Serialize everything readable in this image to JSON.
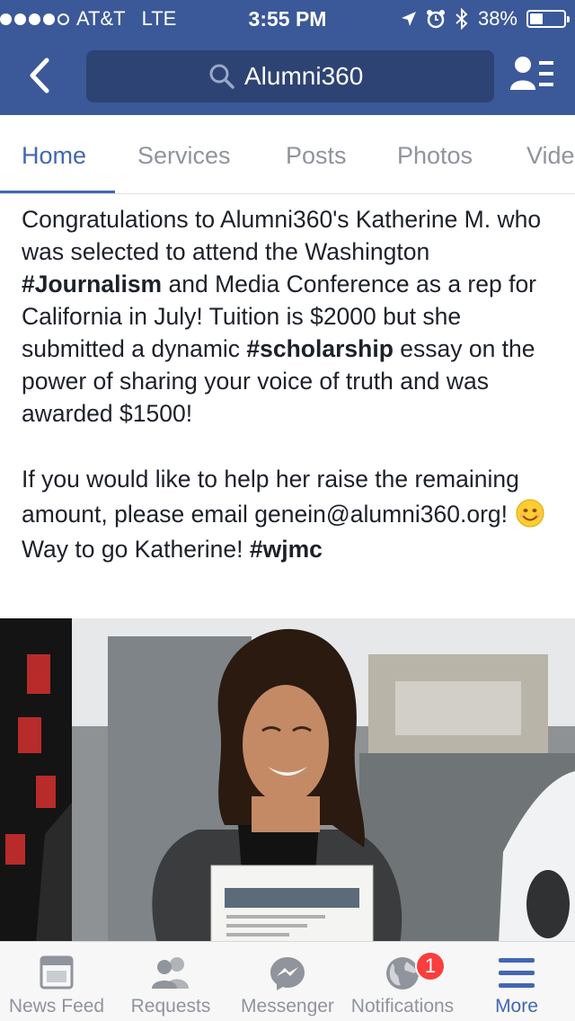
{
  "status_bar": {
    "carrier": "AT&T",
    "network": "LTE",
    "time": "3:55 PM",
    "battery_percent": "38%",
    "battery_level": 0.38,
    "signal_bars": 4,
    "signal_max": 5
  },
  "nav": {
    "search_value": "Alumni360",
    "back_icon": "chevron-left-icon",
    "profile_icon": "profile-list-icon"
  },
  "tabs": [
    {
      "label": "Home",
      "active": true
    },
    {
      "label": "Services",
      "active": false
    },
    {
      "label": "Posts",
      "active": false
    },
    {
      "label": "Photos",
      "active": false
    },
    {
      "label": "Vide",
      "active": false
    }
  ],
  "post": {
    "p1_a": "Congratulations to Alumni360's Katherine M. who was selected to attend the Washington ",
    "p1_hashtag1": "#Journalism",
    "p1_b": " and Media Conference as a rep for California in July! Tuition is $2000 but she submitted a dynamic ",
    "p1_hashtag2": "#scholarship",
    "p1_c": " essay on the power of sharing your voice of truth and was awarded $1500!",
    "p2_a": "If you would like to help her raise the remaining amount, please email genein@alumni360.org!",
    "p2_emoji": "smiling-face-emoji",
    "p2_b": "Way to go Katherine!  ",
    "p2_hashtag": "#wjmc"
  },
  "photo": {
    "description_icon": "photo-image"
  },
  "bottom_bar": {
    "items": [
      {
        "label": "News Feed",
        "icon": "news-feed-icon"
      },
      {
        "label": "Requests",
        "icon": "friend-requests-icon"
      },
      {
        "label": "Messenger",
        "icon": "messenger-icon"
      },
      {
        "label": "Notifications",
        "icon": "globe-icon",
        "badge": "1"
      },
      {
        "label": "More",
        "icon": "menu-icon",
        "active": true
      }
    ]
  },
  "colors": {
    "brand": "#3b5998",
    "accent": "#4267b2",
    "badge": "#fa3e3e"
  }
}
